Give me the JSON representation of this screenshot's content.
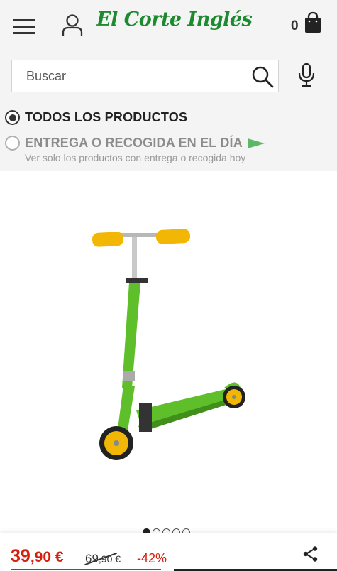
{
  "header": {
    "logo_text": "El Corte Inglés",
    "cart_count": "0",
    "icons": {
      "menu": "hamburger-menu-icon",
      "user": "user-account-icon",
      "cart": "shopping-bag-icon",
      "search": "magnifier-icon",
      "mic": "microphone-icon",
      "share": "share-icon"
    }
  },
  "search": {
    "placeholder": "Buscar",
    "value": ""
  },
  "filters": {
    "all_products": {
      "label": "TODOS LOS PRODUCTOS",
      "selected": true
    },
    "same_day": {
      "label": "ENTREGA O RECOGIDA EN EL DÍA",
      "sublabel": "Ver solo los productos con entrega o recogida hoy",
      "selected": false
    }
  },
  "gallery": {
    "image_count": 5,
    "active_index": 0
  },
  "price": {
    "current_int": "39",
    "current_dec": ",90 €",
    "old_int": "69",
    "old_dec": ",90 €",
    "discount": "-42%"
  },
  "colors": {
    "brand_green": "#1c8a2e",
    "price_red": "#d6200f",
    "flag_green": "#5bb868",
    "scooter_green": "#5fbf2a",
    "grip_yellow": "#f2b705"
  }
}
